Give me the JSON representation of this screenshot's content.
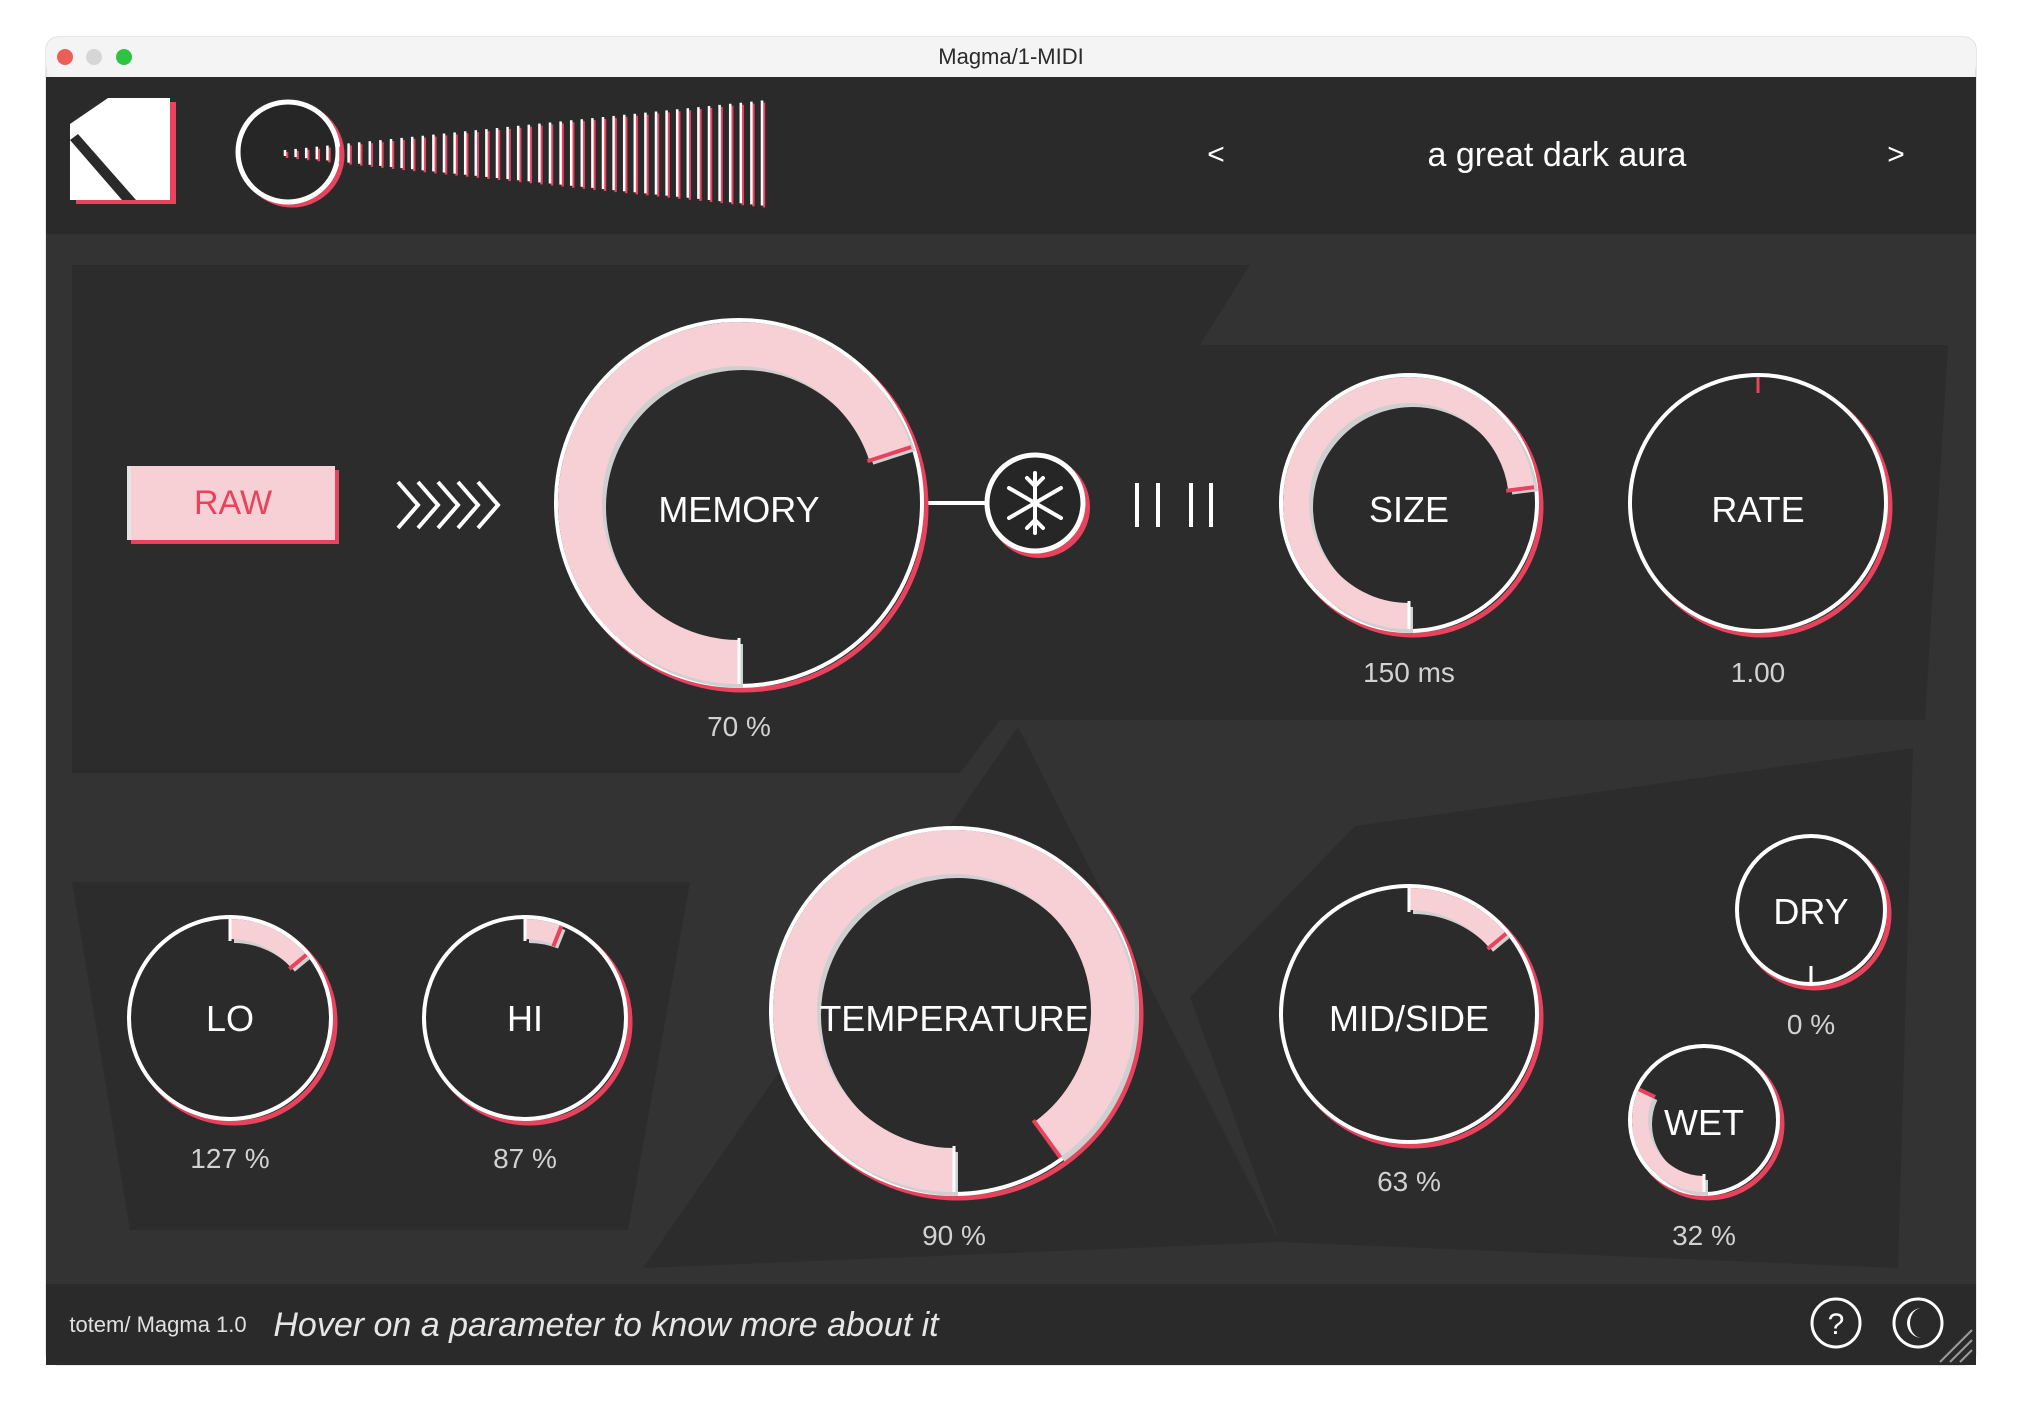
{
  "window": {
    "title": "Magma/1-MIDI"
  },
  "header": {
    "logo_icon": "totem-logo-icon",
    "meter_icon": "input-meter-icon",
    "prev_label": "<",
    "next_label": ">",
    "preset_name": "a great dark aura"
  },
  "main": {
    "raw_button": "RAW",
    "chevrons_icon": "chevrons-right-icon",
    "freeze_icon": "snowflake-icon",
    "bars_icon": "four-bars-icon"
  },
  "knobs": [
    {
      "id": "memory",
      "label": "MEMORY",
      "value": "70 %",
      "level": 0.7
    },
    {
      "id": "size",
      "label": "SIZE",
      "value": "150 ms",
      "level": 0.73
    },
    {
      "id": "rate",
      "label": "RATE",
      "value": "1.00",
      "level": 0.0
    },
    {
      "id": "lo",
      "label": "LO",
      "value": "127 %",
      "level": 0.14
    },
    {
      "id": "hi",
      "label": "HI",
      "value": "87 %",
      "level": 0.06
    },
    {
      "id": "temperature",
      "label": "TEMPERATURE",
      "value": "90 %",
      "level": 0.9
    },
    {
      "id": "midside",
      "label": "MID/SIDE",
      "value": "63 %",
      "level": 0.14
    },
    {
      "id": "dry",
      "label": "DRY",
      "value": "0 %",
      "level": 0.0
    },
    {
      "id": "wet",
      "label": "WET",
      "value": "32 %",
      "level": 0.32
    }
  ],
  "footer": {
    "brand": "totem/ Magma 1.0",
    "hint": "Hover on a parameter to know more about it",
    "help_icon": "help-icon",
    "theme_icon": "moon-icon"
  },
  "colors": {
    "accent": "#e8435d",
    "accent_light": "#f7d0d6",
    "panel_bg": "#333333",
    "header_bg": "#2a2a2a",
    "shape_bg": "#2c2c2c"
  }
}
